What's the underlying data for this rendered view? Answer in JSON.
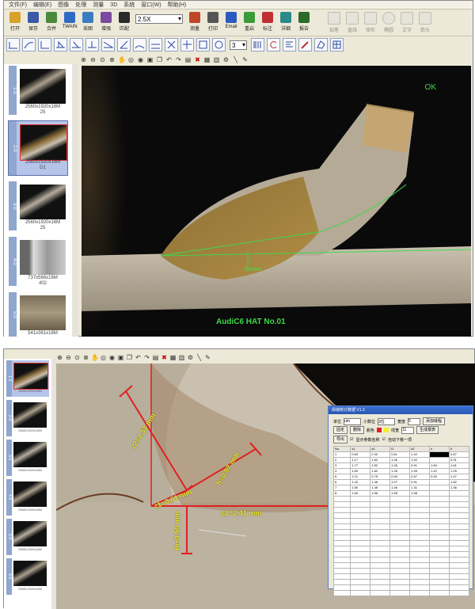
{
  "top_window": {
    "menu": [
      "文件(F)",
      "编辑(E)",
      "图像",
      "处理",
      "测量",
      "3D",
      "系统",
      "窗口(W)",
      "帮助(H)"
    ],
    "toolbar_buttons": [
      {
        "label": "打开",
        "icon": "open-folder-icon",
        "color": "#d9a02a"
      },
      {
        "label": "保存",
        "icon": "save-disk-icon",
        "color": "#3a5aa8"
      },
      {
        "label": "合并",
        "icon": "merge-icon",
        "color": "#4a8a3a"
      },
      {
        "label": "TWAIN",
        "icon": "twain-icon",
        "color": "#2e6bc4"
      },
      {
        "label": "采图",
        "icon": "capture-icon",
        "color": "#3a7cc0"
      },
      {
        "label": "增强",
        "icon": "enhance-icon",
        "color": "#7a4aa0"
      },
      {
        "label": "匹配",
        "icon": "match-icon",
        "color": "#2a2a2a"
      }
    ],
    "zoom_value": "2.5X",
    "toolbar_buttons_right": [
      {
        "label": "测量",
        "icon": "measure-icon",
        "color": "#c0462a"
      },
      {
        "label": "打印",
        "icon": "print-icon",
        "color": "#555555"
      },
      {
        "label": "Email",
        "icon": "email-icon",
        "color": "#2a5ac0"
      },
      {
        "label": "重启",
        "icon": "restart-icon",
        "color": "#3a9a3a"
      },
      {
        "label": "标注",
        "icon": "annotate-icon",
        "color": "#c03030"
      },
      {
        "label": "详细",
        "icon": "detail-icon",
        "color": "#2a8a8a"
      },
      {
        "label": "报告",
        "icon": "report-icon",
        "color": "#2a6a2a"
      }
    ],
    "toolbar_buttons_disabled": [
      "铅笔",
      "直线",
      "矩形",
      "椭圆",
      "文字",
      "箭头"
    ],
    "spin_value": "3",
    "thumbnails": [
      {
        "tag": "1-0",
        "caption": "2560x1920x16M",
        "sub": "25"
      },
      {
        "tag": "2-0",
        "caption": "2560x1920x16M",
        "sub": "D1"
      },
      {
        "tag": "3-0",
        "caption": "2560x1920x16M",
        "sub": "25"
      },
      {
        "tag": "4-0",
        "caption": "737x566x16M",
        "sub": "402"
      },
      {
        "tag": "5-0",
        "caption": "541x361x16M",
        "sub": ""
      }
    ],
    "status_text": "OK",
    "image_caption": "AudiC6 HAT No.01",
    "measurement_label": "0.00mm"
  },
  "bottom_window": {
    "measurements": {
      "z2": "z2=2.53 mm",
      "h": "h=0.87 mm",
      "z1": "z1=0.61 mm",
      "s1": "s1=2.41 mm",
      "fh": "fh=0.59 mm"
    },
    "dialog": {
      "title": "焊缝统计数据 V1.3",
      "unit_label": "单位",
      "unit_value": "um",
      "decimals_label": "小数位",
      "decimals_value": "3位",
      "width_label": "宽度",
      "width_value": "5",
      "fixed_button": "固定",
      "delete_button": "删除",
      "color_label": "颜色",
      "font_label": "线宽",
      "font_value": "11",
      "export_button": "导出",
      "show_param_label": "显示参数名称",
      "auto_next_label": "自动下移一项",
      "tilt_button": "添加缝程",
      "report_button": "生成报表",
      "columns": [
        "No.",
        "s1",
        "a1",
        "t1",
        "a2",
        "s",
        "h"
      ],
      "rows": [
        [
          "1",
          "0.60",
          "2.42",
          "0.61",
          "1.42",
          "",
          "0.87"
        ],
        [
          "2",
          "1.17",
          "1.62",
          "1.26",
          "1.52",
          "",
          "0.91"
        ],
        [
          "3",
          "1.77",
          "1.52",
          "1.26",
          "0.91",
          "1.60",
          "1.61"
        ],
        [
          "4",
          "1.60",
          "1.62",
          "1.26",
          "1.45",
          "1.42",
          "1.25"
        ],
        [
          "5",
          "1.21",
          "0.75",
          "0.94",
          "0.57",
          "0.30",
          "1.47"
        ],
        [
          "6",
          "1.42",
          "1.46",
          "1.07",
          "0.91",
          "",
          "1.82"
        ],
        [
          "7",
          "1.60",
          "1.46",
          "1.46",
          "1.31",
          "",
          "1.36"
        ],
        [
          "8",
          "1.60",
          "1.56",
          "1.55",
          "1.58",
          "",
          ""
        ]
      ]
    },
    "thumbnails": [
      {
        "tag": "1-0",
        "caption": "2560x1920x16M"
      },
      {
        "tag": "2-0",
        "caption": "2560x1920x16M"
      },
      {
        "tag": "3-0",
        "caption": "2560x1920x16M"
      },
      {
        "tag": "4-0",
        "caption": "2560x1920x16M"
      },
      {
        "tag": "5-0",
        "caption": "2560x1920x16M"
      },
      {
        "tag": "6-0",
        "caption": "2560x1920x16M"
      }
    ]
  },
  "colors": {
    "ok_green": "#3fd84a",
    "measure_red": "#e02020",
    "label_yellow": "#f3ee2e",
    "thumb_tag": "#8fa6cf"
  }
}
